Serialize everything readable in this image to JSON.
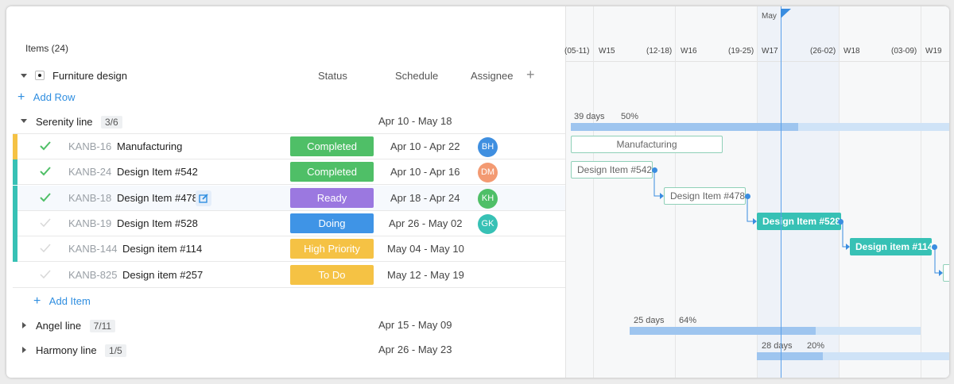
{
  "items_count": "Items (24)",
  "project": {
    "name": "Furniture design"
  },
  "columns": {
    "status": "Status",
    "schedule": "Schedule",
    "assignee": "Assignee",
    "add": "+"
  },
  "add_row": "Add Row",
  "add_item": "Add Item",
  "groups": [
    {
      "name": "Serenity line",
      "count": "3/6",
      "range": "Apr 10 - May 18"
    },
    {
      "name": "Angel line",
      "count": "7/11",
      "range": "Apr 15 - May 09"
    },
    {
      "name": "Harmony line",
      "count": "1/5",
      "range": "Apr 26 - May 23"
    }
  ],
  "rows": [
    {
      "key": "KANB-16",
      "title": "Manufacturing",
      "status": "Completed",
      "status_color": "#4fbf67",
      "schedule": "Apr 10 - Apr 22",
      "assignee": "BH",
      "avatar_color": "#3f8fe0",
      "stripe": "#f5c244",
      "done": true
    },
    {
      "key": "KANB-24",
      "title": "Design Item #542",
      "status": "Completed",
      "status_color": "#4fbf67",
      "schedule": "Apr 10 - Apr 16",
      "assignee": "DM",
      "avatar_color": "#f39a72",
      "stripe": "#37c1b5",
      "done": true
    },
    {
      "key": "KANB-18",
      "title": "Design Item #478",
      "status": "Ready",
      "status_color": "#9b78e0",
      "schedule": "Apr 18 - Apr 24",
      "assignee": "KH",
      "avatar_color": "#4fbf67",
      "stripe": "#37c1b5",
      "done": true
    },
    {
      "key": "KANB-19",
      "title": "Design Item #528",
      "status": "Doing",
      "status_color": "#3f94e6",
      "schedule": "Apr 26 - May 02",
      "assignee": "GK",
      "avatar_color": "#37c1b5",
      "stripe": "#37c1b5",
      "done": false
    },
    {
      "key": "KANB-144",
      "title": "Design item #114",
      "status": "High Priority",
      "status_color": "#f5c244",
      "schedule": "May 04 - May 10",
      "assignee": "",
      "avatar_color": "",
      "stripe": "#37c1b5",
      "done": false
    },
    {
      "key": "KANB-825",
      "title": "Design item #257",
      "status": "To Do",
      "status_color": "#f5c244",
      "schedule": "May 12 - May 19",
      "assignee": "",
      "avatar_color": "",
      "stripe": "",
      "done": false
    }
  ],
  "gantt": {
    "month": "May",
    "weeks": [
      "(05-11)",
      "W15",
      "(12-18)",
      "W16",
      "(19-25)",
      "W17",
      "(26-02)",
      "W18",
      "(03-09)",
      "W19"
    ],
    "serenity_summary": {
      "days": "39 days",
      "percent": "50%",
      "progress": 0.5
    },
    "angel_summary": {
      "days": "25 days",
      "percent": "64%",
      "progress": 0.64
    },
    "harmony_summary": {
      "days": "28 days",
      "percent": "20%",
      "progress": 0.2
    },
    "tasks": [
      "Manufacturing",
      "Design Item #542",
      "Design Item #478",
      "Design Item #528",
      "Design item #114"
    ]
  }
}
